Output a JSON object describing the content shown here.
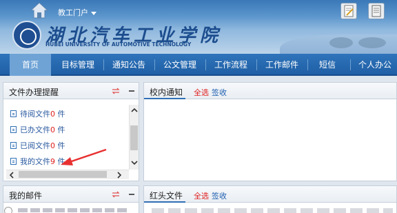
{
  "header": {
    "portal_label": "教工门户",
    "university_cn": "湖北汽车工业学院",
    "university_en": "HUBEI UNIVERSITY OF AUTOMOTIVE TECHNOLOGY"
  },
  "nav": {
    "items": [
      {
        "label": "首页",
        "active": true
      },
      {
        "label": "目标管理",
        "active": false
      },
      {
        "label": "通知公告",
        "active": false
      },
      {
        "label": "公文管理",
        "active": false
      },
      {
        "label": "工作流程",
        "active": false
      },
      {
        "label": "工作邮件",
        "active": false
      },
      {
        "label": "短信",
        "active": false
      },
      {
        "label": "个人办公",
        "active": false
      }
    ]
  },
  "file_panel": {
    "title": "文件办理提醒",
    "items": [
      {
        "label": "待阅文件",
        "count": "0",
        "unit": " 件"
      },
      {
        "label": "已办文件",
        "count": "0",
        "unit": " 件"
      },
      {
        "label": "已阅文件",
        "count": "0",
        "unit": " 件"
      },
      {
        "label": "我的文件",
        "count": "9",
        "unit": " 件"
      }
    ]
  },
  "notice_panel": {
    "title": "校内通知",
    "select_all": "全选",
    "sign": "签收"
  },
  "mail_panel": {
    "title": "我的邮件"
  },
  "redhead_panel": {
    "title": "红头文件",
    "select_all": "全选",
    "sign": "签收"
  },
  "colors": {
    "nav_bg": "#1f5fa5",
    "accent_red": "#e02020",
    "link_blue": "#2060b0"
  }
}
